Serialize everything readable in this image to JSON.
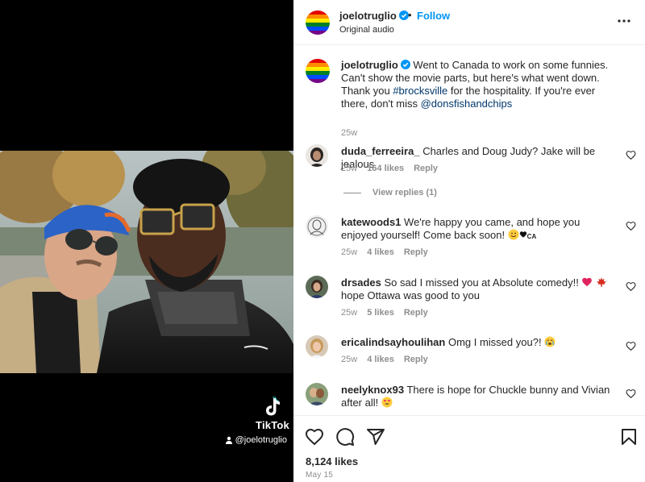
{
  "post": {
    "author": "joelotruglio",
    "follow_label": "Follow",
    "separator": "•",
    "audio": "Original audio"
  },
  "media": {
    "watermark_brand": "TikTok",
    "watermark_handle": "@joelotruglio"
  },
  "caption": {
    "author": "joelotruglio",
    "text_1": "Went to Canada to work on some funnies. Can't show the movie parts, but here's what went down. Thank you ",
    "hashtag": "#brocksville",
    "text_2": " for the hospitality. If you're ever there, don't miss ",
    "mention": "@donsfishandchips",
    "age": "25w"
  },
  "comments": [
    {
      "user": "duda_ferreeira_",
      "text": "Charles and Doug Judy? Jake will be jealous",
      "age": "25w",
      "likes": "164 likes",
      "reply": "Reply",
      "view_replies": "View replies (1)"
    },
    {
      "user": "katewoods1",
      "text": "We're happy you came, and hope you enjoyed yourself! Come back soon! ",
      "emoji_tail": "CA",
      "age": "25w",
      "likes": "4 likes",
      "reply": "Reply"
    },
    {
      "user": "drsades",
      "text_1": "So sad I missed you at Absolute comedy!! ",
      "text_2": " hope Ottawa was good to you",
      "age": "25w",
      "likes": "5 likes",
      "reply": "Reply"
    },
    {
      "user": "ericalindsayhoulihan",
      "text": "Omg I missed you?! ",
      "age": "25w",
      "likes": "4 likes",
      "reply": "Reply"
    },
    {
      "user": "neelyknox93",
      "text": "There is hope for Chuckle bunny and Vivian after all! "
    }
  ],
  "footer": {
    "likes": "8,124 likes",
    "date": "May 15"
  },
  "icons": [
    "verified-badge-icon",
    "more-options-icon",
    "heart-icon",
    "comment-icon",
    "share-icon",
    "bookmark-icon",
    "tiktok-logo-icon"
  ],
  "colors": {
    "link_blue": "#0095f6",
    "tag_blue": "#00376b",
    "muted": "#8e8e8e",
    "text": "#262626"
  }
}
